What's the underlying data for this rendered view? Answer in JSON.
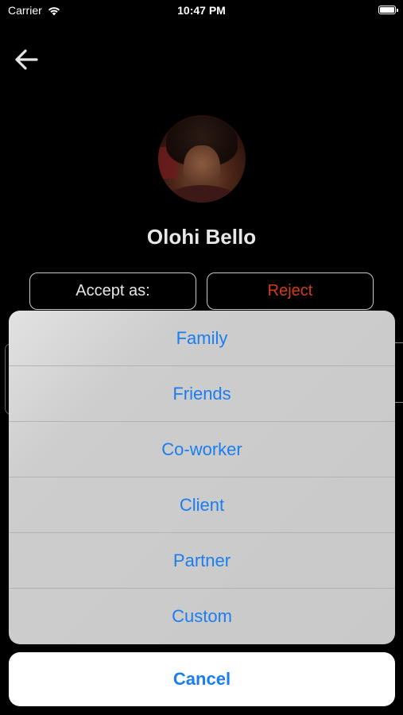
{
  "status_bar": {
    "carrier": "Carrier",
    "time": "10:47 PM",
    "battery_level": 1.0
  },
  "header": {
    "back_icon": "arrow-left-icon"
  },
  "profile": {
    "name": "Olohi Bello"
  },
  "actions": {
    "accept_label": "Accept as:",
    "reject_label": "Reject",
    "reject_color": "#d33b1c"
  },
  "action_sheet": {
    "options": [
      {
        "label": "Family"
      },
      {
        "label": "Friends"
      },
      {
        "label": "Co-worker"
      },
      {
        "label": "Client"
      },
      {
        "label": "Partner"
      },
      {
        "label": "Custom"
      }
    ],
    "cancel_label": "Cancel",
    "accent_color": "#1a7ef0"
  }
}
